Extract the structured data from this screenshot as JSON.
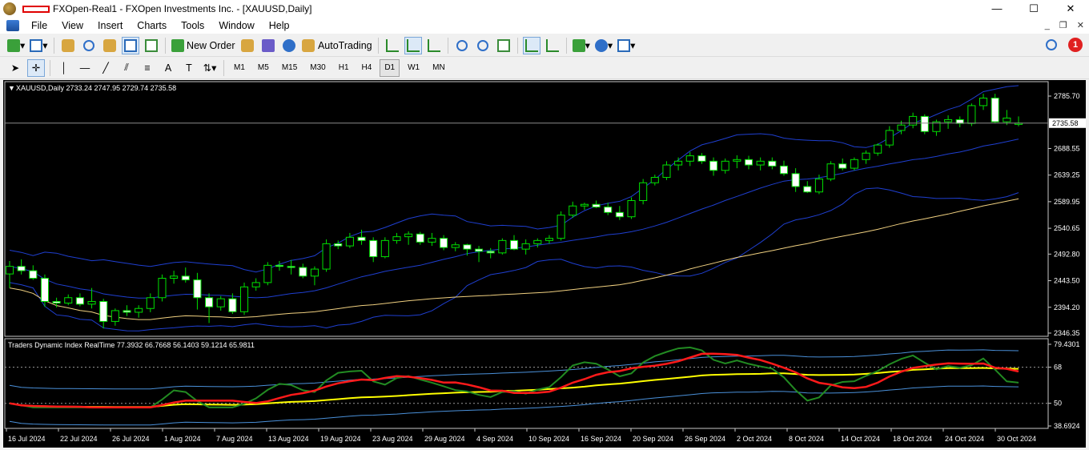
{
  "window": {
    "title": "FXOpen-Real1 - FXOpen Investments Inc. - [XAUUSD,Daily]",
    "buttons": [
      "—",
      "☐",
      "✕"
    ]
  },
  "menu": {
    "items": [
      "File",
      "View",
      "Insert",
      "Charts",
      "Tools",
      "Window",
      "Help"
    ],
    "mdi": [
      "_",
      "❐",
      "✕"
    ]
  },
  "toolbar": {
    "new_order": "New Order",
    "autotrading": "AutoTrading",
    "notification_count": "1"
  },
  "timeframes": {
    "items": [
      "M1",
      "M5",
      "M15",
      "M30",
      "H1",
      "H4",
      "D1",
      "W1",
      "MN"
    ],
    "active": "D1"
  },
  "chart_data": [
    {
      "type": "candlestick",
      "title": "XAUUSD,Daily 2733.24 2747.95 2729.74 2735.58",
      "symbol": "XAUUSD",
      "timeframe": "Daily",
      "ohlc": {
        "open": 2733.24,
        "high": 2747.95,
        "low": 2729.74,
        "close": 2735.58
      },
      "current_price_label": "2735.58",
      "y_ticks": [
        "2785.70",
        "2735.58",
        "2688.55",
        "2639.25",
        "2589.95",
        "2540.65",
        "2492.80",
        "2443.50",
        "2394.20",
        "2346.35"
      ],
      "ylim": [
        2346.35,
        2785.7
      ],
      "x_ticks": [
        "16 Jul 2024",
        "22 Jul 2024",
        "26 Jul 2024",
        "1 Aug 2024",
        "7 Aug 2024",
        "13 Aug 2024",
        "19 Aug 2024",
        "23 Aug 2024",
        "29 Aug 2024",
        "4 Sep 2024",
        "10 Sep 2024",
        "16 Sep 2024",
        "20 Sep 2024",
        "26 Sep 2024",
        "2 Oct 2024",
        "8 Oct 2024",
        "14 Oct 2024",
        "18 Oct 2024",
        "24 Oct 2024",
        "30 Oct 2024"
      ],
      "candles": [
        [
          2456,
          2480,
          2430,
          2470
        ],
        [
          2470,
          2483,
          2455,
          2462
        ],
        [
          2462,
          2472,
          2445,
          2448
        ],
        [
          2448,
          2455,
          2395,
          2405
        ],
        [
          2405,
          2412,
          2394,
          2402
        ],
        [
          2402,
          2418,
          2398,
          2412
        ],
        [
          2412,
          2420,
          2396,
          2400
        ],
        [
          2400,
          2430,
          2392,
          2405
        ],
        [
          2405,
          2410,
          2355,
          2368
        ],
        [
          2368,
          2392,
          2360,
          2388
        ],
        [
          2388,
          2398,
          2378,
          2385
        ],
        [
          2385,
          2398,
          2375,
          2392
        ],
        [
          2392,
          2420,
          2385,
          2412
        ],
        [
          2412,
          2455,
          2405,
          2448
        ],
        [
          2448,
          2462,
          2438,
          2452
        ],
        [
          2452,
          2468,
          2440,
          2445
        ],
        [
          2445,
          2458,
          2390,
          2412
        ],
        [
          2412,
          2420,
          2365,
          2395
        ],
        [
          2395,
          2415,
          2388,
          2410
        ],
        [
          2410,
          2420,
          2382,
          2386
        ],
        [
          2386,
          2440,
          2380,
          2432
        ],
        [
          2432,
          2448,
          2425,
          2440
        ],
        [
          2440,
          2478,
          2435,
          2472
        ],
        [
          2472,
          2480,
          2462,
          2470
        ],
        [
          2470,
          2482,
          2455,
          2468
        ],
        [
          2468,
          2475,
          2448,
          2452
        ],
        [
          2452,
          2470,
          2435,
          2465
        ],
        [
          2465,
          2520,
          2460,
          2512
        ],
        [
          2512,
          2518,
          2502,
          2508
        ],
        [
          2508,
          2532,
          2504,
          2524
        ],
        [
          2524,
          2538,
          2510,
          2518
        ],
        [
          2518,
          2524,
          2478,
          2488
        ],
        [
          2488,
          2524,
          2485,
          2518
        ],
        [
          2518,
          2532,
          2512,
          2525
        ],
        [
          2525,
          2535,
          2510,
          2530
        ],
        [
          2530,
          2534,
          2510,
          2515
        ],
        [
          2515,
          2532,
          2508,
          2522
        ],
        [
          2522,
          2528,
          2500,
          2505
        ],
        [
          2505,
          2515,
          2498,
          2510
        ],
        [
          2510,
          2512,
          2490,
          2502
        ],
        [
          2502,
          2508,
          2478,
          2498
        ],
        [
          2498,
          2504,
          2485,
          2495
        ],
        [
          2495,
          2522,
          2492,
          2518
        ],
        [
          2518,
          2528,
          2500,
          2502
        ],
        [
          2502,
          2520,
          2492,
          2512
        ],
        [
          2512,
          2522,
          2505,
          2518
        ],
        [
          2518,
          2528,
          2512,
          2522
        ],
        [
          2522,
          2572,
          2518,
          2565
        ],
        [
          2565,
          2590,
          2560,
          2582
        ],
        [
          2582,
          2588,
          2575,
          2585
        ],
        [
          2585,
          2592,
          2578,
          2580
        ],
        [
          2580,
          2588,
          2565,
          2570
        ],
        [
          2570,
          2582,
          2556,
          2562
        ],
        [
          2562,
          2598,
          2558,
          2592
        ],
        [
          2592,
          2632,
          2585,
          2625
        ],
        [
          2625,
          2640,
          2620,
          2635
        ],
        [
          2635,
          2665,
          2630,
          2658
        ],
        [
          2658,
          2672,
          2648,
          2665
        ],
        [
          2665,
          2682,
          2656,
          2675
        ],
        [
          2675,
          2680,
          2660,
          2665
        ],
        [
          2665,
          2672,
          2638,
          2648
        ],
        [
          2648,
          2670,
          2642,
          2665
        ],
        [
          2665,
          2676,
          2652,
          2668
        ],
        [
          2668,
          2675,
          2650,
          2658
        ],
        [
          2658,
          2672,
          2648,
          2665
        ],
        [
          2665,
          2672,
          2650,
          2656
        ],
        [
          2656,
          2666,
          2638,
          2642
        ],
        [
          2642,
          2652,
          2608,
          2618
        ],
        [
          2618,
          2628,
          2606,
          2608
        ],
        [
          2608,
          2640,
          2604,
          2632
        ],
        [
          2632,
          2665,
          2628,
          2660
        ],
        [
          2660,
          2670,
          2648,
          2652
        ],
        [
          2652,
          2672,
          2648,
          2668
        ],
        [
          2668,
          2685,
          2660,
          2680
        ],
        [
          2680,
          2698,
          2675,
          2695
        ],
        [
          2695,
          2730,
          2690,
          2722
        ],
        [
          2722,
          2740,
          2715,
          2732
        ],
        [
          2732,
          2755,
          2726,
          2748
        ],
        [
          2748,
          2752,
          2715,
          2720
        ],
        [
          2720,
          2742,
          2712,
          2738
        ],
        [
          2738,
          2750,
          2725,
          2742
        ],
        [
          2742,
          2748,
          2728,
          2735
        ],
        [
          2735,
          2772,
          2730,
          2768
        ],
        [
          2768,
          2790,
          2760,
          2782
        ],
        [
          2782,
          2790,
          2735,
          2738
        ],
        [
          2738,
          2760,
          2732,
          2745
        ],
        [
          2733.24,
          2747.95,
          2729.74,
          2735.58
        ]
      ]
    },
    {
      "type": "line",
      "title": "Traders Dynamic Index RealTime 77.3932 66.7668 56.1403 59.1214 65.9811",
      "y_ticks": [
        "79.4301",
        "68",
        "50",
        "38.6924"
      ],
      "ylim": [
        38.6924,
        79.4301
      ],
      "levels": [
        68,
        50
      ]
    }
  ],
  "colors": {
    "bull_candle": "#00e000",
    "bear_body": "#ffffff",
    "bollinger": "#1f3fd0",
    "ma_slow": "#f0d080",
    "tdi_green": "#228b22",
    "tdi_red": "#ff1a1a",
    "tdi_yellow": "#ffff00",
    "tdi_bands": "#4a90d9"
  }
}
